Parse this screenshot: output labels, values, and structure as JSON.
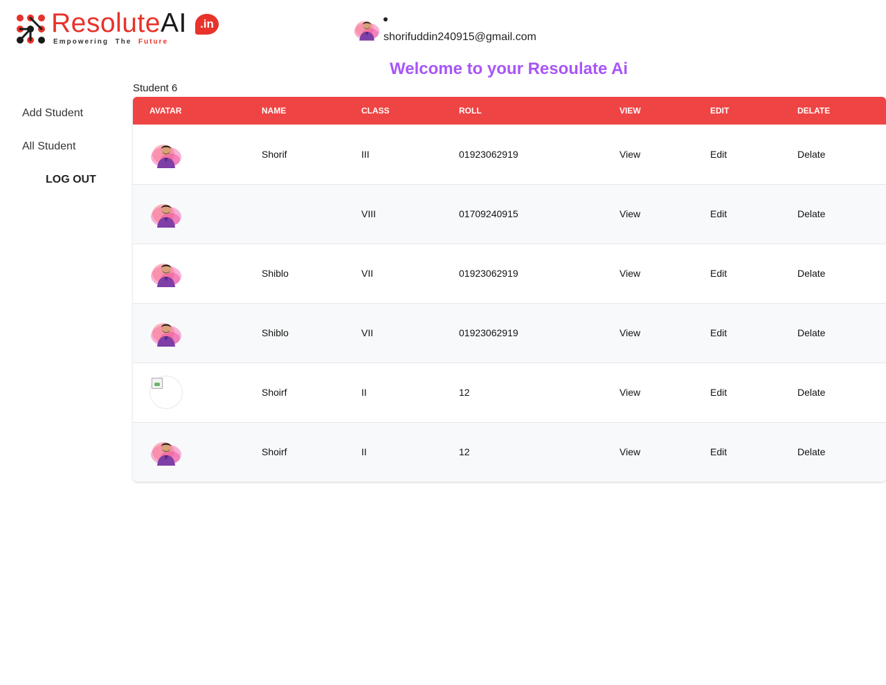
{
  "brand": {
    "word_part1": "Resolute",
    "word_part2": "AI",
    "badge": ".in",
    "tagline_part1": "Empowering  The  ",
    "tagline_part2": "Future",
    "colors": {
      "red": "#e8322a",
      "dark": "#1a1a1a"
    }
  },
  "header": {
    "user_email": "shorifuddin240915@gmail.com",
    "user_avatar_icon": "user-photo-avatar",
    "welcome": "Welcome to your Resoulate Ai",
    "welcome_color": "#a855f7"
  },
  "sidebar": {
    "items": [
      {
        "label": "Add Student"
      },
      {
        "label": "All Student"
      },
      {
        "label": "LOG OUT"
      }
    ]
  },
  "main": {
    "student_count": "Student 6",
    "header_color": "#ef4444",
    "columns": [
      "AVATAR",
      "NAME",
      "CLASS",
      "ROLL",
      "VIEW",
      "EDIT",
      "DELATE"
    ],
    "rows": [
      {
        "avatar": "photo",
        "name": "Shorif",
        "class": "III",
        "roll": "01923062919",
        "view": "View",
        "edit": "Edit",
        "delete": "Delate"
      },
      {
        "avatar": "photo",
        "name": "",
        "class": "VIII",
        "roll": "01709240915",
        "view": "View",
        "edit": "Edit",
        "delete": "Delate"
      },
      {
        "avatar": "photo",
        "name": "Shiblo",
        "class": "VII",
        "roll": "01923062919",
        "view": "View",
        "edit": "Edit",
        "delete": "Delate"
      },
      {
        "avatar": "photo",
        "name": "Shiblo",
        "class": "VII",
        "roll": "01923062919",
        "view": "View",
        "edit": "Edit",
        "delete": "Delate"
      },
      {
        "avatar": "broken-image",
        "name": "Shoirf",
        "class": "II",
        "roll": "12",
        "view": "View",
        "edit": "Edit",
        "delete": "Delate"
      },
      {
        "avatar": "photo",
        "name": "Shoirf",
        "class": "II",
        "roll": "12",
        "view": "View",
        "edit": "Edit",
        "delete": "Delate"
      }
    ]
  }
}
